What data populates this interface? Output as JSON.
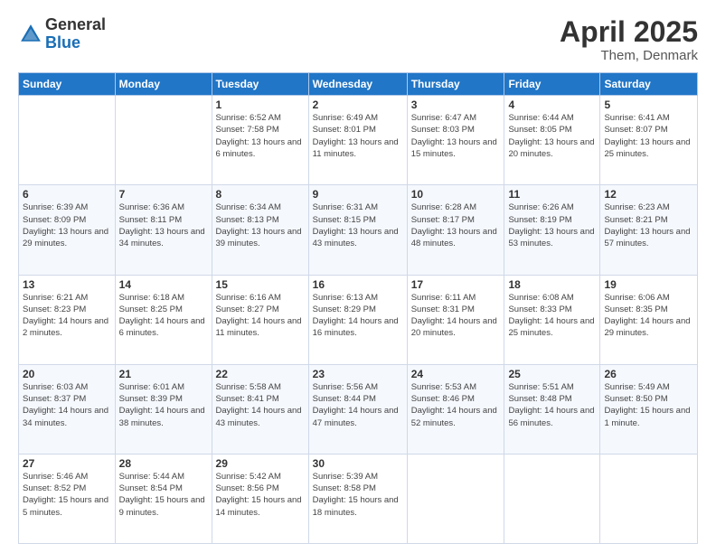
{
  "header": {
    "logo_general": "General",
    "logo_blue": "Blue",
    "month_year": "April 2025",
    "location": "Them, Denmark"
  },
  "days_of_week": [
    "Sunday",
    "Monday",
    "Tuesday",
    "Wednesday",
    "Thursday",
    "Friday",
    "Saturday"
  ],
  "weeks": [
    [
      {
        "num": "",
        "info": ""
      },
      {
        "num": "",
        "info": ""
      },
      {
        "num": "1",
        "info": "Sunrise: 6:52 AM\nSunset: 7:58 PM\nDaylight: 13 hours and 6 minutes."
      },
      {
        "num": "2",
        "info": "Sunrise: 6:49 AM\nSunset: 8:01 PM\nDaylight: 13 hours and 11 minutes."
      },
      {
        "num": "3",
        "info": "Sunrise: 6:47 AM\nSunset: 8:03 PM\nDaylight: 13 hours and 15 minutes."
      },
      {
        "num": "4",
        "info": "Sunrise: 6:44 AM\nSunset: 8:05 PM\nDaylight: 13 hours and 20 minutes."
      },
      {
        "num": "5",
        "info": "Sunrise: 6:41 AM\nSunset: 8:07 PM\nDaylight: 13 hours and 25 minutes."
      }
    ],
    [
      {
        "num": "6",
        "info": "Sunrise: 6:39 AM\nSunset: 8:09 PM\nDaylight: 13 hours and 29 minutes."
      },
      {
        "num": "7",
        "info": "Sunrise: 6:36 AM\nSunset: 8:11 PM\nDaylight: 13 hours and 34 minutes."
      },
      {
        "num": "8",
        "info": "Sunrise: 6:34 AM\nSunset: 8:13 PM\nDaylight: 13 hours and 39 minutes."
      },
      {
        "num": "9",
        "info": "Sunrise: 6:31 AM\nSunset: 8:15 PM\nDaylight: 13 hours and 43 minutes."
      },
      {
        "num": "10",
        "info": "Sunrise: 6:28 AM\nSunset: 8:17 PM\nDaylight: 13 hours and 48 minutes."
      },
      {
        "num": "11",
        "info": "Sunrise: 6:26 AM\nSunset: 8:19 PM\nDaylight: 13 hours and 53 minutes."
      },
      {
        "num": "12",
        "info": "Sunrise: 6:23 AM\nSunset: 8:21 PM\nDaylight: 13 hours and 57 minutes."
      }
    ],
    [
      {
        "num": "13",
        "info": "Sunrise: 6:21 AM\nSunset: 8:23 PM\nDaylight: 14 hours and 2 minutes."
      },
      {
        "num": "14",
        "info": "Sunrise: 6:18 AM\nSunset: 8:25 PM\nDaylight: 14 hours and 6 minutes."
      },
      {
        "num": "15",
        "info": "Sunrise: 6:16 AM\nSunset: 8:27 PM\nDaylight: 14 hours and 11 minutes."
      },
      {
        "num": "16",
        "info": "Sunrise: 6:13 AM\nSunset: 8:29 PM\nDaylight: 14 hours and 16 minutes."
      },
      {
        "num": "17",
        "info": "Sunrise: 6:11 AM\nSunset: 8:31 PM\nDaylight: 14 hours and 20 minutes."
      },
      {
        "num": "18",
        "info": "Sunrise: 6:08 AM\nSunset: 8:33 PM\nDaylight: 14 hours and 25 minutes."
      },
      {
        "num": "19",
        "info": "Sunrise: 6:06 AM\nSunset: 8:35 PM\nDaylight: 14 hours and 29 minutes."
      }
    ],
    [
      {
        "num": "20",
        "info": "Sunrise: 6:03 AM\nSunset: 8:37 PM\nDaylight: 14 hours and 34 minutes."
      },
      {
        "num": "21",
        "info": "Sunrise: 6:01 AM\nSunset: 8:39 PM\nDaylight: 14 hours and 38 minutes."
      },
      {
        "num": "22",
        "info": "Sunrise: 5:58 AM\nSunset: 8:41 PM\nDaylight: 14 hours and 43 minutes."
      },
      {
        "num": "23",
        "info": "Sunrise: 5:56 AM\nSunset: 8:44 PM\nDaylight: 14 hours and 47 minutes."
      },
      {
        "num": "24",
        "info": "Sunrise: 5:53 AM\nSunset: 8:46 PM\nDaylight: 14 hours and 52 minutes."
      },
      {
        "num": "25",
        "info": "Sunrise: 5:51 AM\nSunset: 8:48 PM\nDaylight: 14 hours and 56 minutes."
      },
      {
        "num": "26",
        "info": "Sunrise: 5:49 AM\nSunset: 8:50 PM\nDaylight: 15 hours and 1 minute."
      }
    ],
    [
      {
        "num": "27",
        "info": "Sunrise: 5:46 AM\nSunset: 8:52 PM\nDaylight: 15 hours and 5 minutes."
      },
      {
        "num": "28",
        "info": "Sunrise: 5:44 AM\nSunset: 8:54 PM\nDaylight: 15 hours and 9 minutes."
      },
      {
        "num": "29",
        "info": "Sunrise: 5:42 AM\nSunset: 8:56 PM\nDaylight: 15 hours and 14 minutes."
      },
      {
        "num": "30",
        "info": "Sunrise: 5:39 AM\nSunset: 8:58 PM\nDaylight: 15 hours and 18 minutes."
      },
      {
        "num": "",
        "info": ""
      },
      {
        "num": "",
        "info": ""
      },
      {
        "num": "",
        "info": ""
      }
    ]
  ]
}
